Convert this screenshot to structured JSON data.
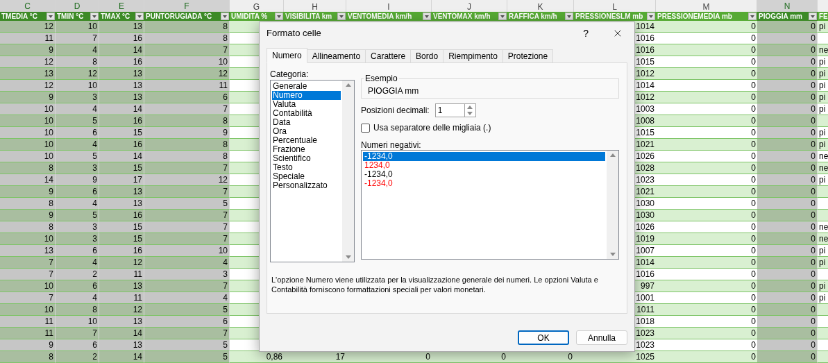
{
  "sheet": {
    "columns": [
      {
        "letter": "C",
        "header": "TMEDIA °C",
        "selected": true
      },
      {
        "letter": "D",
        "header": "TMIN °C",
        "selected": true
      },
      {
        "letter": "E",
        "header": "TMAX °C",
        "selected": true
      },
      {
        "letter": "F",
        "header": "PUNTORUGIADA °C",
        "selected": true
      },
      {
        "letter": "G",
        "header": "UMIDITA %",
        "selected": false
      },
      {
        "letter": "H",
        "header": "VISIBILITA km",
        "selected": false
      },
      {
        "letter": "I",
        "header": "VENTOMEDIA km/h",
        "selected": false
      },
      {
        "letter": "J",
        "header": "VENTOMAX km/h",
        "selected": false
      },
      {
        "letter": "K",
        "header": "RAFFICA km/h",
        "selected": false
      },
      {
        "letter": "L",
        "header": "PRESSIONESLM mb",
        "selected": false
      },
      {
        "letter": "M",
        "header": "PRESSIONEMEDIA mb",
        "selected": false
      },
      {
        "letter": "N",
        "header": "PIOGGIA mm",
        "selected": true
      },
      {
        "header": "FE",
        "selected": false
      }
    ],
    "rows": [
      {
        "c": "12",
        "d": "10",
        "e": "13",
        "f": "8",
        "l": "1014",
        "m": "0",
        "n": "0",
        "o": "pi"
      },
      {
        "c": "11",
        "d": "7",
        "e": "16",
        "f": "8",
        "l": "1016",
        "m": "0",
        "n": "0"
      },
      {
        "c": "9",
        "d": "4",
        "e": "14",
        "f": "7",
        "l": "1016",
        "m": "0",
        "n": "0",
        "o": "ne"
      },
      {
        "c": "12",
        "d": "8",
        "e": "16",
        "f": "10",
        "l": "1015",
        "m": "0",
        "n": "0",
        "o": "pi"
      },
      {
        "c": "13",
        "d": "12",
        "e": "13",
        "f": "12",
        "l": "1012",
        "m": "0",
        "n": "0",
        "o": "pi"
      },
      {
        "c": "12",
        "d": "10",
        "e": "13",
        "f": "11",
        "l": "1014",
        "m": "0",
        "n": "0",
        "o": "pi"
      },
      {
        "c": "9",
        "d": "3",
        "e": "13",
        "f": "6",
        "l": "1012",
        "m": "0",
        "n": "0",
        "o": "pi"
      },
      {
        "c": "10",
        "d": "4",
        "e": "14",
        "f": "7",
        "l": "1003",
        "m": "0",
        "n": "0",
        "o": "pi"
      },
      {
        "c": "10",
        "d": "5",
        "e": "16",
        "f": "8",
        "l": "1008",
        "m": "0",
        "n": "0"
      },
      {
        "c": "10",
        "d": "6",
        "e": "15",
        "f": "9",
        "l": "1015",
        "m": "0",
        "n": "0",
        "o": "pi"
      },
      {
        "c": "10",
        "d": "4",
        "e": "16",
        "f": "8",
        "l": "1021",
        "m": "0",
        "n": "0",
        "o": "pi"
      },
      {
        "c": "10",
        "d": "5",
        "e": "14",
        "f": "8",
        "l": "1026",
        "m": "0",
        "n": "0",
        "o": "ne"
      },
      {
        "c": "8",
        "d": "3",
        "e": "15",
        "f": "7",
        "l": "1028",
        "m": "0",
        "n": "0",
        "o": "ne"
      },
      {
        "c": "14",
        "d": "9",
        "e": "17",
        "f": "12",
        "l": "1023",
        "m": "0",
        "n": "0",
        "o": "pi"
      },
      {
        "c": "9",
        "d": "6",
        "e": "13",
        "f": "7",
        "l": "1021",
        "m": "0",
        "n": "0"
      },
      {
        "c": "8",
        "d": "4",
        "e": "13",
        "f": "5",
        "l": "1030",
        "m": "0",
        "n": "0"
      },
      {
        "c": "9",
        "d": "5",
        "e": "16",
        "f": "7",
        "l": "1030",
        "m": "0",
        "n": "0"
      },
      {
        "c": "8",
        "d": "3",
        "e": "15",
        "f": "7",
        "l": "1026",
        "m": "0",
        "n": "0",
        "o": "ne"
      },
      {
        "c": "10",
        "d": "3",
        "e": "15",
        "f": "7",
        "l": "1019",
        "m": "0",
        "n": "0",
        "o": "ne"
      },
      {
        "c": "13",
        "d": "6",
        "e": "16",
        "f": "10",
        "l": "1007",
        "m": "0",
        "n": "0",
        "o": "pi"
      },
      {
        "c": "7",
        "d": "4",
        "e": "12",
        "f": "4",
        "l": "1014",
        "m": "0",
        "n": "0",
        "o": "pi"
      },
      {
        "c": "7",
        "d": "2",
        "e": "11",
        "f": "3",
        "l": "1016",
        "m": "0",
        "n": "0"
      },
      {
        "c": "10",
        "d": "6",
        "e": "13",
        "f": "7",
        "l": "997",
        "m": "0",
        "n": "0",
        "o": "pi"
      },
      {
        "c": "7",
        "d": "4",
        "e": "11",
        "f": "4",
        "l": "1001",
        "m": "0",
        "n": "0",
        "o": "pi"
      },
      {
        "c": "10",
        "d": "8",
        "e": "12",
        "f": "5",
        "l": "1011",
        "m": "0",
        "n": "0"
      },
      {
        "c": "11",
        "d": "10",
        "e": "13",
        "f": "6",
        "l": "1018",
        "m": "0",
        "n": "0"
      },
      {
        "c": "11",
        "d": "7",
        "e": "14",
        "f": "7",
        "l": "1023",
        "m": "0",
        "n": "0"
      },
      {
        "c": "9",
        "d": "6",
        "e": "13",
        "f": "5",
        "l": "1023",
        "m": "0",
        "n": "0"
      },
      {
        "c": "8",
        "d": "2",
        "e": "14",
        "f": "5",
        "g": "0,86",
        "h": "17",
        "i": "0",
        "j": "0",
        "k": "0",
        "l": "1025",
        "m": "0",
        "n": "0"
      }
    ]
  },
  "dialog": {
    "title": "Formato celle",
    "help": "?",
    "tabs": [
      {
        "label": "Numero",
        "selected": true
      },
      {
        "label": "Allineamento",
        "selected": false
      },
      {
        "label": "Carattere",
        "selected": false
      },
      {
        "label": "Bordo",
        "selected": false
      },
      {
        "label": "Riempimento",
        "selected": false
      },
      {
        "label": "Protezione",
        "selected": false
      }
    ],
    "category_label": "Categoria:",
    "categories": [
      {
        "label": "Generale",
        "selected": false
      },
      {
        "label": "Numero",
        "selected": true
      },
      {
        "label": "Valuta",
        "selected": false
      },
      {
        "label": "Contabilità",
        "selected": false
      },
      {
        "label": "Data",
        "selected": false
      },
      {
        "label": "Ora",
        "selected": false
      },
      {
        "label": "Percentuale",
        "selected": false
      },
      {
        "label": "Frazione",
        "selected": false
      },
      {
        "label": "Scientifico",
        "selected": false
      },
      {
        "label": "Testo",
        "selected": false
      },
      {
        "label": "Speciale",
        "selected": false
      },
      {
        "label": "Personalizzato",
        "selected": false
      }
    ],
    "sample": {
      "legend": "Esempio",
      "value": "PIOGGIA mm"
    },
    "decimals": {
      "label": "Posizioni decimali:",
      "value": "1"
    },
    "thousands": {
      "label": "Usa separatore delle migliaia (.)",
      "checked": false
    },
    "negatives_label": "Numeri negativi:",
    "negatives": [
      {
        "text": "-1234,0",
        "red": false,
        "selected": true
      },
      {
        "text": "1234,0",
        "red": true,
        "selected": false
      },
      {
        "text": "-1234,0",
        "red": false,
        "selected": false
      },
      {
        "text": "-1234,0",
        "red": true,
        "selected": false
      }
    ],
    "description": "L'opzione Numero viene utilizzata per la visualizzazione generale dei numeri. Le opzioni Valuta e Contabilità forniscono formattazioni speciali per valori monetari.",
    "buttons": [
      {
        "label": "OK",
        "default": true
      },
      {
        "label": "Annulla",
        "default": false
      }
    ]
  }
}
